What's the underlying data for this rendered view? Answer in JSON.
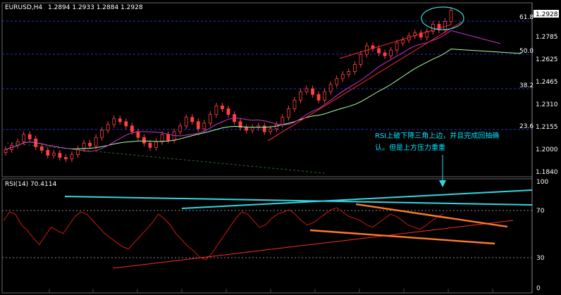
{
  "header": {
    "symbol": "EURUSD,H4",
    "ohlc": "1.2894 1.2933 1.2884 1.2928"
  },
  "price_axis": {
    "current_price": "1.2928",
    "ticks": [
      "1.2785",
      "1.2625",
      "1.2465",
      "1.2310",
      "1.2155",
      "1.2000",
      "1.1840"
    ],
    "fib_levels": [
      "61.8",
      "50.0",
      "38.2",
      "23.6"
    ]
  },
  "rsi_panel": {
    "title": "RSI(14) 70.4114",
    "ticks": [
      "100",
      "70",
      "30",
      "0"
    ]
  },
  "annotation": {
    "line1": "RSI上破下降三角上边，并且完成回抽确",
    "line2": "认。但是上方压力重重"
  },
  "colors": {
    "background": "#000000",
    "grid": "#555555",
    "candle_up": "#ff4040",
    "candle_down": "#ff4040",
    "ma_fast": "#cc33cc",
    "ma_slow": "#aaffaa",
    "trendline": "#ff2a2a",
    "rsi_line": "#d01818",
    "annotation": "#00e5ff",
    "rsi_trend_cyan": "#33d6e0",
    "rsi_trend_orange": "#ff7a2a"
  },
  "chart_data": {
    "type": "candlestick",
    "title": "EURUSD,H4",
    "ylim": [
      1.18,
      1.296
    ],
    "close_series": [
      1.1955,
      1.1985,
      1.201,
      1.206,
      1.203,
      1.1975,
      1.195,
      1.1915,
      1.193,
      1.19,
      1.189,
      1.192,
      1.196,
      1.2,
      1.198,
      1.204,
      1.209,
      1.213,
      1.217,
      1.215,
      1.212,
      1.208,
      1.204,
      1.2,
      1.197,
      1.201,
      1.206,
      1.202,
      1.208,
      1.212,
      1.218,
      1.215,
      1.21,
      1.214,
      1.22,
      1.226,
      1.224,
      1.22,
      1.215,
      1.211,
      1.209,
      1.211,
      1.212,
      1.208,
      1.21,
      1.213,
      1.218,
      1.224,
      1.23,
      1.236,
      1.238,
      1.234,
      1.23,
      1.236,
      1.241,
      1.245,
      1.248,
      1.25,
      1.255,
      1.262,
      1.268,
      1.266,
      1.263,
      1.261,
      1.265,
      1.27,
      1.272,
      1.275,
      1.277,
      1.274,
      1.278,
      1.283,
      1.279,
      1.285,
      1.2928
    ],
    "rsi_values": [
      64,
      72,
      70,
      60,
      55,
      48,
      42,
      50,
      58,
      55,
      52,
      60,
      68,
      72,
      70,
      64,
      58,
      52,
      48,
      44,
      40,
      38,
      44,
      50,
      56,
      62,
      70,
      66,
      60,
      52,
      46,
      40,
      36,
      30,
      28,
      34,
      42,
      50,
      58,
      66,
      72,
      70,
      64,
      58,
      60,
      66,
      70,
      72,
      74,
      70,
      64,
      60,
      62,
      66,
      70,
      74,
      76,
      72,
      68,
      66,
      64,
      60,
      58,
      62,
      66,
      70,
      68,
      64,
      60,
      58,
      56,
      60,
      64,
      68,
      70.41
    ],
    "rsi_ylim": [
      0,
      100
    ]
  }
}
